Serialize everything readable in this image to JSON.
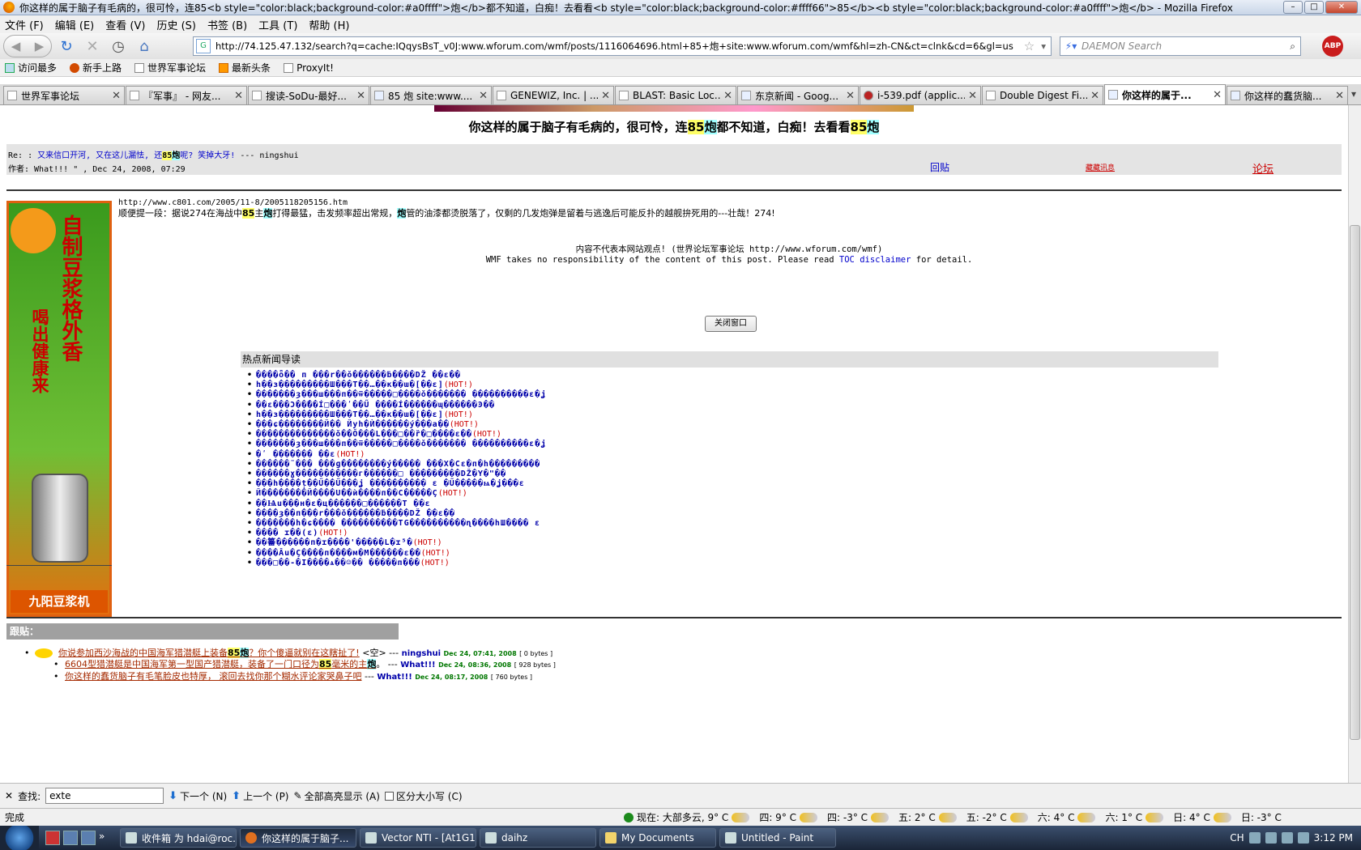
{
  "window": {
    "title": "你这样的属于脑子有毛病的，很可怜，连85<b style=\"color:black;background-color:#a0ffff\">炮</b>都不知道，白痴！去看看<b style=\"color:black;background-color:#ffff66\">85</b><b style=\"color:black;background-color:#a0ffff\">炮</b> - Mozilla Firefox",
    "min": "–",
    "max": "□",
    "close": "✕"
  },
  "menu": [
    "文件 (F)",
    "编辑 (E)",
    "查看 (V)",
    "历史 (S)",
    "书签 (B)",
    "工具 (T)",
    "帮助 (H)"
  ],
  "nav": {
    "url": "http://74.125.47.132/search?q=cache:IQqysBsT_v0J:www.wforum.com/wmf/posts/1116064696.html+85+炮+site:www.wforum.com/wmf&hl=zh-CN&ct=clnk&cd=6&gl=us",
    "search_placeholder": "DAEMON Search",
    "abp": "ABP"
  },
  "bookmarks": [
    "访问最多",
    "新手上路",
    "世界军事论坛",
    "最新头条",
    "ProxyIt!"
  ],
  "tabs": [
    {
      "label": "世界军事论坛",
      "active": false
    },
    {
      "label": "『军事』 - 网友...",
      "active": false
    },
    {
      "label": "搜读-SoDu-最好...",
      "active": false
    },
    {
      "label": "85 炮 site:www....",
      "active": false
    },
    {
      "label": "GENEWIZ, Inc. | ...",
      "active": false
    },
    {
      "label": "BLAST: Basic Loc...",
      "active": false
    },
    {
      "label": "东京新闻 - Goog...",
      "active": false
    },
    {
      "label": "i-539.pdf (applic...",
      "active": false
    },
    {
      "label": "Double Digest Fi...",
      "active": false
    },
    {
      "label": "你这样的属于...",
      "active": true
    },
    {
      "label": "你这样的蠢货脑...",
      "active": false
    }
  ],
  "page": {
    "title_pre": "你这样的属于脑子有毛病的，很可怜，连",
    "title_85a": "85",
    "title_pao_a": "炮",
    "title_mid": "都不知道，白痴！去看看",
    "title_85b": "85",
    "title_pao_b": "炮",
    "re_prefix": "Re: : ",
    "re_link_pre": "又来信口开河, 又在这儿漏怯, 还",
    "re_link_85": "85",
    "re_link_pao": "炮",
    "re_link_post": "呢? 笑掉大牙!",
    "re_author": " --- ningshui",
    "author_line": "作者: What!!! \" , Dec 24, 2008, 07:29",
    "reply_link": "回贴",
    "hide_link": "藏藏讯息",
    "forum_link": "论坛",
    "post_url": "http://www.c801.com/2005/11-8/2005118205156.htm",
    "post_body_pre": "顺便提一段：据说274在海战中",
    "post_body_85": "85",
    "post_body_zhu": "主",
    "post_body_pao": "炮",
    "post_body_mid": "打得最猛，击发频率超出常规，",
    "post_body_pao2": "炮",
    "post_body_post": "管的油漆都烫脱落了，仅剩的几发炮弹是留着与逃逸后可能反扑的越舰拚死用的---壮哉！274!",
    "disclaimer_cn": "内容不代表本网站观点! (世界论坛军事论坛 http://www.wforum.com/wmf)",
    "disclaimer_en_pre": "WMF takes no responsibility of the content of this post. Please read ",
    "disclaimer_link": "TOC disclaimer",
    "disclaimer_en_post": " for detail.",
    "close_button": "关闭窗口",
    "news_header": "热点新闻导读",
    "news": [
      {
        "text": "����ȫ�� п ���r��ǒ������ḃ����DŽ ��ɛ��",
        "hot": ""
      },
      {
        "text": "h��з���������Ш���T��…��к��ɯ�[��ɛ]",
        "hot": "(HOT!)"
      },
      {
        "text": "�������ȝ���ш���п��ѿ�����□����ǒ�������  ����������ɛ�ʝ",
        "hot": ""
      },
      {
        "text": "��ɛ���Ͻ��̄��Í□���ʹ��Ű  ����Í������ɰ������Ͽ��",
        "hot": ""
      },
      {
        "text": "h��з���������Ш���T��…��к��ɯ�[��ɛ]",
        "hot": "(HOT!)"
      },
      {
        "text": "���ɕ��������Й��  Йуh�Ѝ������ý���a��",
        "hot": "(HOT!)"
      },
      {
        "text": "��������������ǒ��Ǒ���L���□��ȑ�□����ɛ��",
        "hot": "(HOT!)"
      },
      {
        "text": "�������ȝ���ш���п��ѿ�����□����ǒ�������  ����������ɛ�ʝ",
        "hot": ""
      },
      {
        "text": "�ʹ �������  ��ɛ",
        "hot": "(HOT!)"
      },
      {
        "text": "������˜���  ���ɡ��������ý�����  ���Х�Cɛ�п�h���������",
        "hot": ""
      },
      {
        "text": "������ɣ�����������г������□  ���������DŽ�Y�\"��",
        "hot": ""
      },
      {
        "text": "���h����ț��Ű��Ű���ʝ  ����������  ɛ �Ű�����ѩ�ʝ���ɛ",
        "hot": ""
      },
      {
        "text": "Й��������Й����U��ѝ����п��C�����Ç",
        "hot": "(HOT!)"
      },
      {
        "text": "��Ѩu���н�ɛ�ц������□������T  ��ɛ",
        "hot": ""
      },
      {
        "text": "����ȝ��п���r���ǒ������ḃ����DŽ ��ɛ��",
        "hot": ""
      },
      {
        "text": "�������h�ɕ����  ����������TG����������ɳ����hШ����  ɛ",
        "hot": ""
      },
      {
        "text": "����  ɪ��(ɛ)",
        "hot": "(HOT!)"
      },
      {
        "text": "��䉒������п�ɪ����'�����L�ɪ⁵�",
        "hot": "(HOT!)"
      },
      {
        "text": "����Âu�Ç����п����м�M������ɛ��",
        "hot": "(HOT!)"
      },
      {
        "text": "���□��-�I����ѧ��☺��  �����п���",
        "hot": "(HOT!)"
      }
    ],
    "followups_header": "跟贴：",
    "followups": [
      {
        "pre": "你说参加西沙海战的中国海军猎潜艇上装备",
        "h85": "85",
        "pao": "炮",
        "post": "？你个傻逼就别在这瞎扯了!",
        "tail": " <空> --- ",
        "author": "ningshui",
        "date": "Dec 24, 07:41, 2008",
        "size": "[ 0 bytes ]"
      },
      {
        "pre": "6604型猎潜艇是中国海军第一型国产猎潜艇，装备了一门口径为",
        "h85": "85",
        "pao": "炮",
        "post": "毫米的主",
        "tail": "。 --- ",
        "author": "What!!!",
        "date": "Dec 24, 08:36, 2008",
        "size": "[ 928 bytes ]"
      },
      {
        "pre": "你这样的蠢货脑子有毛笔脸皮也特厚， 滚回去找你那个糊水评论家哭鼻子吧",
        "h85": "",
        "pao": "",
        "post": "",
        "tail": " --- ",
        "author": "What!!!",
        "date": "Dec 24, 08:17, 2008",
        "size": "[ 760 bytes ]"
      }
    ],
    "ad": {
      "line1": "自制豆浆格外香",
      "line2": "喝出健康来",
      "brand": "九阳豆浆机"
    }
  },
  "findbar": {
    "close": "✕",
    "label": "查找:",
    "value": "exte",
    "next": "下一个 (N)",
    "prev": "上一个 (P)",
    "highlight": "全部高亮显示 (A)",
    "matchcase": "区分大小写 (C)"
  },
  "statusbar": {
    "status": "完成",
    "weather": [
      "现在: 大部多云, 9° C",
      "四: 9° C",
      "四: -3° C",
      "五: 2° C",
      "五: -2° C",
      "六: 4° C",
      "六: 1° C",
      "日: 4° C",
      "日: -3° C"
    ]
  },
  "taskbar": {
    "tasks": [
      {
        "label": "收件箱 为 hdai@roc...",
        "active": false
      },
      {
        "label": "你这样的属于脑子...",
        "active": true
      },
      {
        "label": "Vector NTI - [At1G1...",
        "active": false
      },
      {
        "label": "daihz",
        "active": false
      },
      {
        "label": "My Documents",
        "active": false
      },
      {
        "label": "Untitled - Paint",
        "active": false
      }
    ],
    "lang": "CH",
    "clock": "3:12 PM"
  }
}
